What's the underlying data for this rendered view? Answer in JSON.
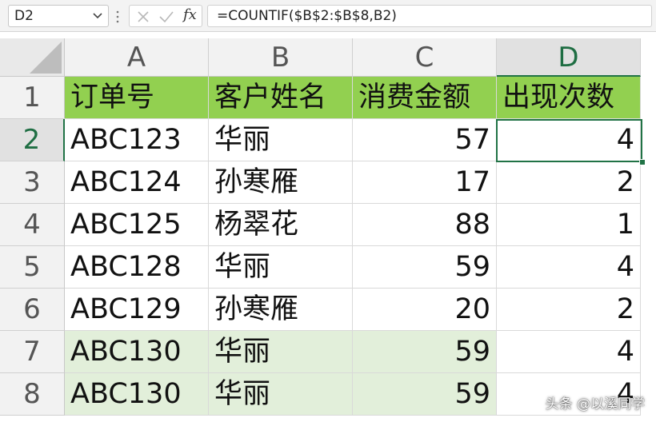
{
  "formula_bar": {
    "name_box": "D2",
    "fx_label": "fx",
    "formula": "=COUNTIF($B$2:$B$8,B2)"
  },
  "sheet": {
    "columns": [
      "A",
      "B",
      "C",
      "D"
    ],
    "active_column": "D",
    "row_numbers": [
      "1",
      "2",
      "3",
      "4",
      "5",
      "6",
      "7",
      "8"
    ],
    "active_row": "2",
    "header": [
      "订单号",
      "客户姓名",
      "消费金额",
      "出现次数"
    ],
    "rows": [
      [
        "ABC123",
        "华丽",
        "57",
        "4"
      ],
      [
        "ABC124",
        "孙寒雁",
        "17",
        "2"
      ],
      [
        "ABC125",
        "杨翠花",
        "88",
        "1"
      ],
      [
        "ABC128",
        "华丽",
        "59",
        "4"
      ],
      [
        "ABC129",
        "孙寒雁",
        "20",
        "2"
      ],
      [
        "ABC130",
        "华丽",
        "59",
        "4"
      ],
      [
        "ABC130",
        "华丽",
        "59",
        "4"
      ]
    ]
  },
  "colors": {
    "header_fill": "#92d050",
    "duplicate_fill": "#e2efda",
    "selection_border": "#217346"
  },
  "watermark": "头条 @以溪同学"
}
